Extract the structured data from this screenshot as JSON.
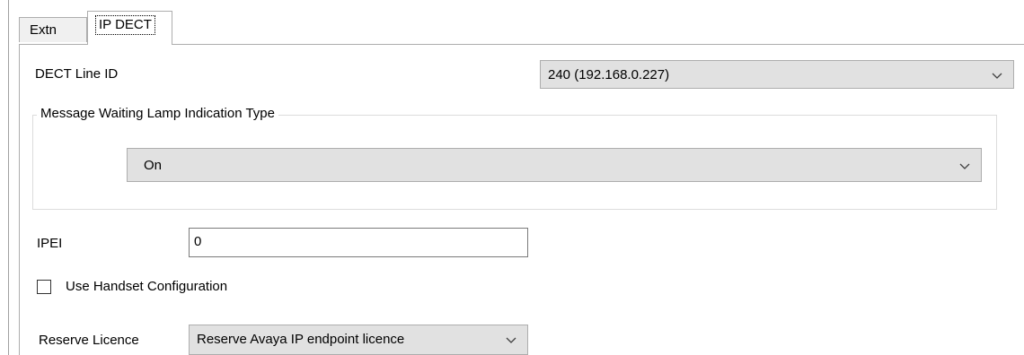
{
  "tabs": [
    {
      "label": "Extn",
      "selected": false
    },
    {
      "label": "IP DECT",
      "selected": true
    }
  ],
  "dect_line": {
    "label": "DECT Line ID",
    "value": "240 (192.168.0.227)"
  },
  "mwl_group": {
    "legend": "Message Waiting Lamp Indication Type",
    "value": "On"
  },
  "ipei": {
    "label": "IPEI",
    "value": "0"
  },
  "handset_config": {
    "label": "Use Handset Configuration",
    "checked": false
  },
  "reserve_licence": {
    "label": "Reserve Licence",
    "value": "Reserve Avaya IP endpoint licence"
  },
  "icons": {
    "dropdown": "chevron-down-icon",
    "checkbox": "checkbox-icon"
  },
  "colors": {
    "control_face": "#e1e1e1",
    "border": "#adadad",
    "tab_inactive": "#f0f0f0"
  }
}
